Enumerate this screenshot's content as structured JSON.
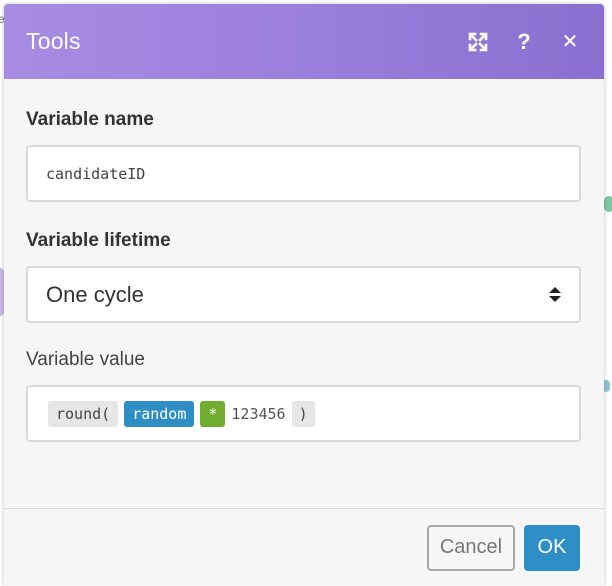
{
  "background": {
    "fragment_text": "e"
  },
  "dialog": {
    "title": "Tools",
    "header_icons": [
      "expand-icon",
      "help-icon",
      "close-icon"
    ],
    "help_glyph": "?",
    "close_glyph": "✕"
  },
  "fields": {
    "variable_name": {
      "label": "Variable name",
      "value": "candidateID"
    },
    "variable_lifetime": {
      "label": "Variable lifetime",
      "selected": "One cycle"
    },
    "variable_value": {
      "label": "Variable value",
      "tokens": {
        "fn": "round(",
        "var": "random",
        "op": "*",
        "number": "123456",
        "close": ")"
      }
    }
  },
  "footer": {
    "cancel_label": "Cancel",
    "ok_label": "OK"
  },
  "colors": {
    "header_gradient_start": "#a88be3",
    "header_gradient_end": "#8b6fd0",
    "ok_button": "#2e8fc6",
    "variable_token": "#2f8fc4",
    "operator_token": "#6fad30"
  }
}
